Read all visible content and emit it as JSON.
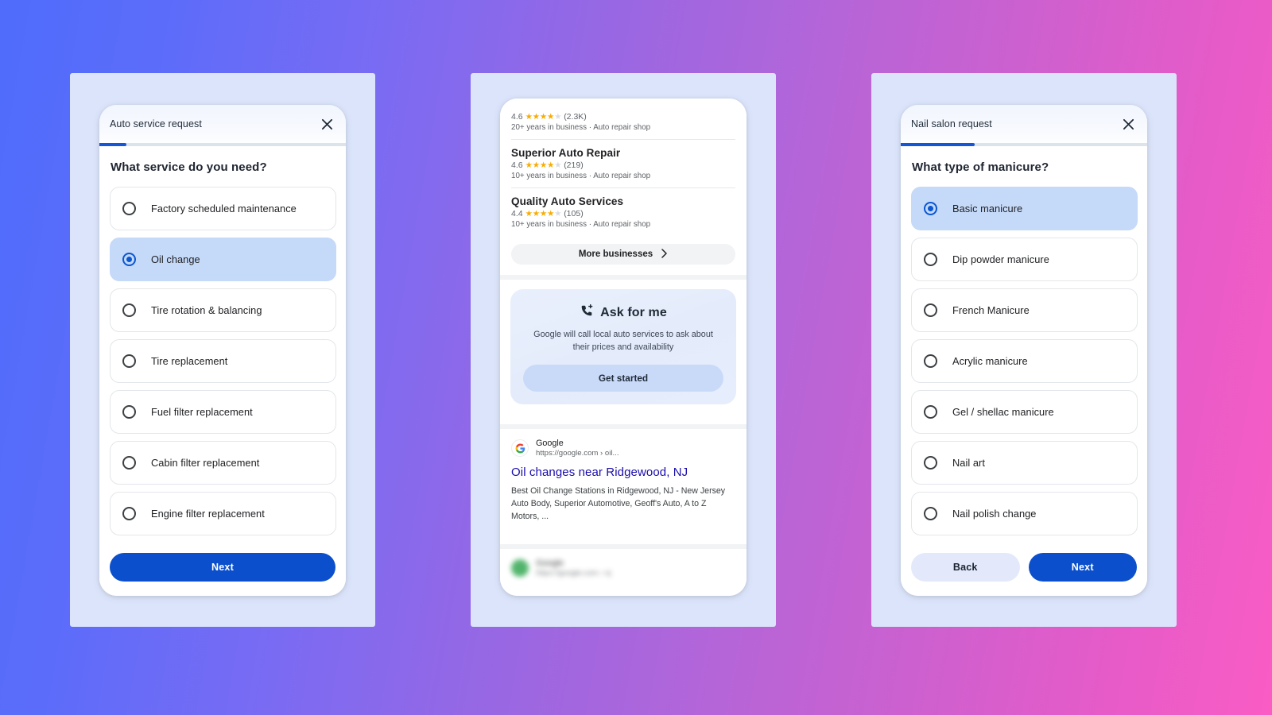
{
  "background": {
    "gradient_from": "#4f6cfb",
    "gradient_to": "#fa5cc4",
    "panel_color": "#dbe4fa"
  },
  "accent": {
    "primary_blue": "#0b4fcc",
    "selected_fill": "#c5d9f8",
    "link_blue": "#1a0dab",
    "star_gold": "#f9ab00"
  },
  "panel1": {
    "title": "Auto service request",
    "close_icon": "close-icon",
    "progress_percent": 11,
    "question": "What service do you need?",
    "options": [
      {
        "label": "Factory scheduled maintenance",
        "selected": false
      },
      {
        "label": "Oil change",
        "selected": true
      },
      {
        "label": "Tire rotation & balancing",
        "selected": false
      },
      {
        "label": "Tire replacement",
        "selected": false
      },
      {
        "label": "Fuel filter replacement",
        "selected": false
      },
      {
        "label": "Cabin filter replacement",
        "selected": false
      },
      {
        "label": "Engine filter replacement",
        "selected": false
      }
    ],
    "next_label": "Next"
  },
  "panel2": {
    "businesses": [
      {
        "name": "",
        "clipped": true,
        "rating": "4.6",
        "stars_filled": 4,
        "stars_total": 5,
        "reviews": "(2.3K)",
        "meta": "20+ years in business  ·  Auto repair shop"
      },
      {
        "name": "Superior Auto Repair",
        "clipped": false,
        "rating": "4.6",
        "stars_filled": 4,
        "stars_total": 5,
        "reviews": "(219)",
        "meta": "10+ years in business  ·  Auto repair shop"
      },
      {
        "name": "Quality Auto Services",
        "clipped": false,
        "rating": "4.4",
        "stars_filled": 4,
        "stars_total": 5,
        "reviews": "(105)",
        "meta": "10+ years in business  ·  Auto repair shop"
      }
    ],
    "more_businesses_label": "More businesses",
    "more_businesses_icon": "chevron-right-icon",
    "ask_for_me": {
      "icon": "phone-plus-icon",
      "title": "Ask for me",
      "description": "Google will call local auto services to ask about their prices and availability",
      "cta_label": "Get started"
    },
    "result": {
      "favicon": "google-g-icon",
      "source": "Google",
      "url": "https://google.com › oil...",
      "title": "Oil changes near Ridgewood, NJ",
      "snippet": "Best Oil Change Stations in Ridgewood, NJ - New Jersey Auto Body, Superior Automotive, Geoff's Auto, A to Z Motors, ..."
    },
    "blurred_result": {
      "favicon": "green-favicon-icon",
      "source": "Google",
      "url": "https://google.com › nj"
    }
  },
  "panel3": {
    "title": "Nail salon request",
    "close_icon": "close-icon",
    "progress_percent": 30,
    "question": "What type of manicure?",
    "options": [
      {
        "label": "Basic manicure",
        "selected": true
      },
      {
        "label": "Dip powder manicure",
        "selected": false
      },
      {
        "label": "French Manicure",
        "selected": false
      },
      {
        "label": "Acrylic manicure",
        "selected": false
      },
      {
        "label": "Gel / shellac manicure",
        "selected": false
      },
      {
        "label": "Nail art",
        "selected": false
      },
      {
        "label": "Nail polish change",
        "selected": false
      }
    ],
    "back_label": "Back",
    "next_label": "Next"
  }
}
